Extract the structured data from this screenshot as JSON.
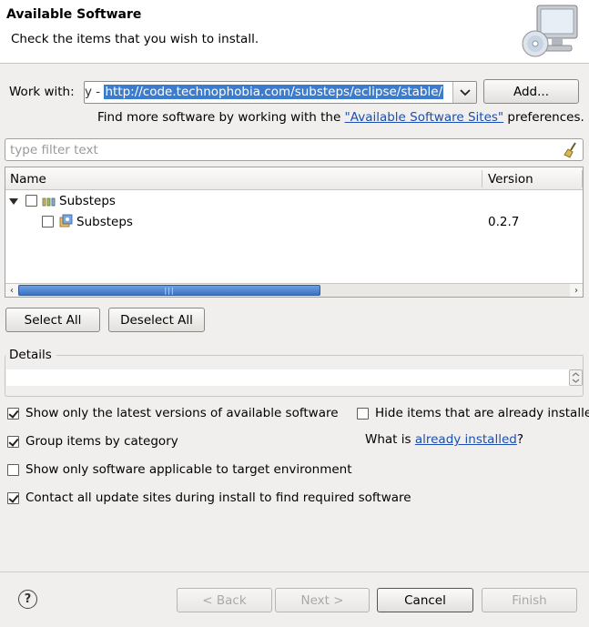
{
  "header": {
    "title": "Available Software",
    "subtitle": "Check the items that you wish to install.",
    "icon": "computer-cd-icon"
  },
  "work_with": {
    "label": "Work with:",
    "prefix": "y - ",
    "value": "http://code.technophobia.com/substeps/eclipse/stable/",
    "add_button": "Add...",
    "find_more_prefix": "Find more software by working with the ",
    "find_more_link": "\"Available Software Sites\"",
    "find_more_suffix": " preferences."
  },
  "filter": {
    "placeholder": "type filter text",
    "value": ""
  },
  "table": {
    "columns": [
      "Name",
      "Version"
    ],
    "rows": [
      {
        "name": "Substeps",
        "version": "",
        "level": 0,
        "expanded": true,
        "checked": false,
        "icon": "category-icon"
      },
      {
        "name": "Substeps",
        "version": "0.2.7",
        "level": 1,
        "checked": false,
        "icon": "feature-icon"
      }
    ]
  },
  "buttons": {
    "select_all": "Select All",
    "deselect_all": "Deselect All"
  },
  "details": {
    "label": "Details",
    "text": ""
  },
  "options": {
    "latest_versions": {
      "label": "Show only the latest versions of available software",
      "checked": true
    },
    "hide_installed": {
      "label": "Hide items that are already installe",
      "checked": false
    },
    "group_by_category": {
      "label": "Group items by category",
      "checked": true
    },
    "what_is_prefix": "What is ",
    "what_is_link": "already installed",
    "what_is_suffix": "?",
    "target_env": {
      "label": "Show only software applicable to target environment",
      "checked": false
    },
    "contact_sites": {
      "label": "Contact all update sites during install to find required software",
      "checked": true
    }
  },
  "footer": {
    "back": "< Back",
    "next": "Next >",
    "cancel": "Cancel",
    "finish": "Finish"
  }
}
